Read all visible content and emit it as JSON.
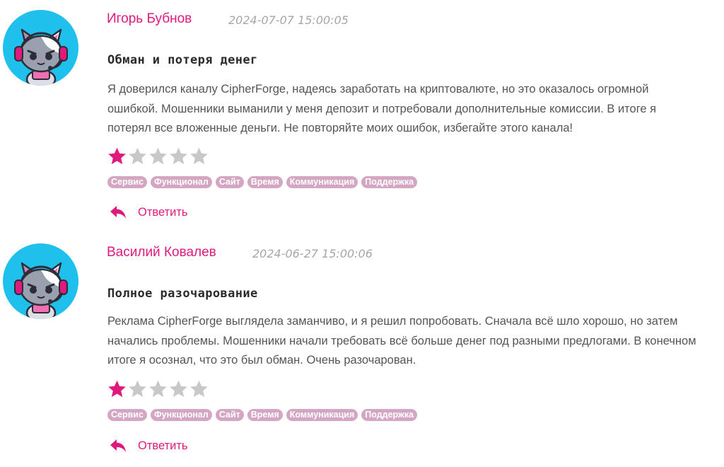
{
  "colors": {
    "accent": "#e0197d",
    "star_filled": "#e0197d",
    "star_empty": "#c8c8c8",
    "tag_bg": "#d5a6c3",
    "avatar_bg": "#1fc1ec"
  },
  "reviews": [
    {
      "author": "Игорь Бубнов",
      "date": "2024-07-07 15:00:05",
      "title": "Обман и потеря денег",
      "body": "Я доверился каналу CipherForge, надеясь заработать на криптовалюте, но это оказалось огромной ошибкой. Мошенники выманили у меня депозит и потребовали дополнительные комиссии. В итоге я потерял все вложенные деньги. Не повторяйте моих ошибок, избегайте этого канала!",
      "rating": 1,
      "rating_max": 5,
      "avatar_icon": "gamer-cat-avatar-icon",
      "tags": [
        "Сервис",
        "Функционал",
        "Сайт",
        "Время",
        "Коммуникация",
        "Поддержка"
      ],
      "reply_label": "Ответить",
      "reply_icon": "reply-arrow-icon"
    },
    {
      "author": "Василий Ковалев",
      "date": "2024-06-27 15:00:06",
      "title": "Полное разочарование",
      "body": "Реклама CipherForge выглядела заманчиво, и я решил попробовать. Сначала всё шло хорошо, но затем начались проблемы. Мошенники начали требовать всё больше денег под разными предлогами. В конечном итоге я осознал, что это был обман. Очень разочарован.",
      "rating": 1,
      "rating_max": 5,
      "avatar_icon": "gamer-cat-avatar-icon",
      "tags": [
        "Сервис",
        "Функционал",
        "Сайт",
        "Время",
        "Коммуникация",
        "Поддержка"
      ],
      "reply_label": "Ответить",
      "reply_icon": "reply-arrow-icon"
    }
  ]
}
